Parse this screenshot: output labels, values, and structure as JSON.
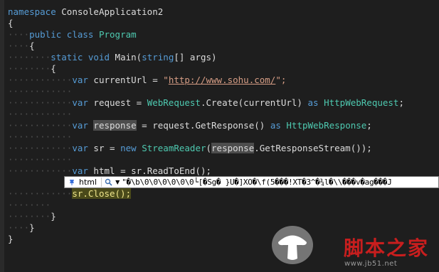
{
  "code": {
    "l1": {
      "kw": "namespace",
      "name": "ConsoleApplication2"
    },
    "l2": "{",
    "l3": {
      "kw1": "public",
      "kw2": "class",
      "name": "Program"
    },
    "l4": "{",
    "l5": {
      "kw1": "static",
      "kw2": "void",
      "name": "Main",
      "p1": "(",
      "ptype": "string",
      "p2": "[] args)"
    },
    "l6": "{",
    "l7": {
      "kw": "var",
      "ident": "currentUrl",
      "eq": "=",
      "q1": "\"",
      "url": "http://www.sohu.com/",
      "q2": "\";"
    },
    "l8": {
      "kw": "var",
      "ident": "request",
      "eq": "=",
      "type": "WebRequest",
      "call": ".Create(currentUrl)",
      "as": "as",
      "type2": "HttpWebRequest",
      "end": ";"
    },
    "l9": {
      "kw": "var",
      "ident": "response",
      "eq": "=",
      "call": "request.GetResponse()",
      "as": "as",
      "type2": "HttpWebResponse",
      "end": ";"
    },
    "l10": {
      "kw": "var",
      "ident": "sr",
      "eq": "=",
      "new": "new",
      "type": "StreamReader",
      "p1": "(",
      "arg": "response",
      "rest": ".GetResponseStream());"
    },
    "l11": {
      "kw": "var",
      "ident": "html",
      "eq": "=",
      "call": "sr.ReadToEnd();"
    },
    "l12": "sr.Close();",
    "l13": "}",
    "l14": "}",
    "l15": "}"
  },
  "datatip": {
    "name": "html",
    "value": "\"�\\b\\0\\0\\0\\0\\0\\0└[�Sg� }U�]XO�\\f(5���!XT�3^�¾l�\\\\���v�ag���J"
  },
  "watermark": {
    "text": "脚本之家",
    "url": "www.jb51.net"
  }
}
